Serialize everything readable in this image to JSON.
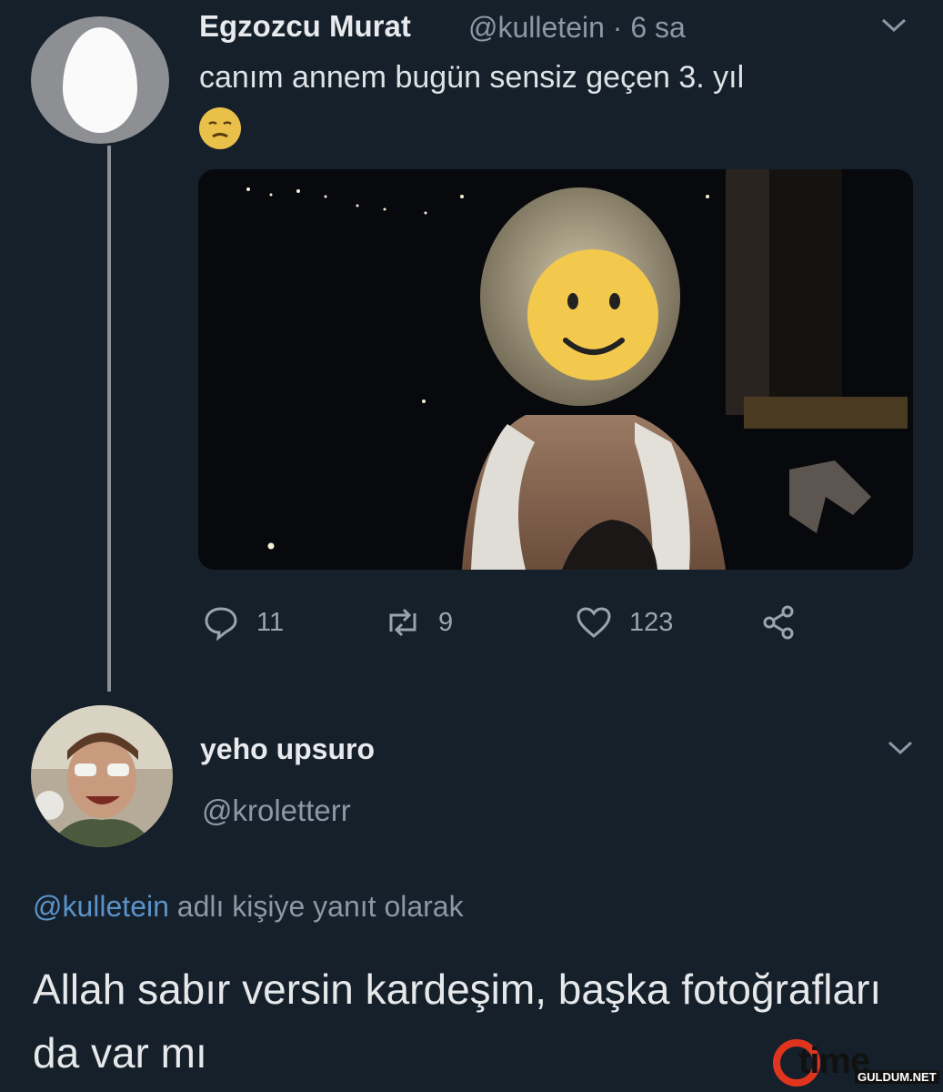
{
  "tweet": {
    "author_name": "Egzozcu Murat",
    "meta": "@kulletein · 6 sa",
    "text": "canım annem bugün sensiz geçen 3. yıl",
    "emoji": "sad-face-emoji",
    "stats": {
      "replies": "11",
      "retweets": "9",
      "likes": "123"
    }
  },
  "reply": {
    "author_name": "yeho upsuro",
    "handle": "@kroletterr",
    "reply_mention": "@kulletein",
    "reply_suffix": " adlı kişiye yanıt olarak",
    "text": "Allah sabır versin kardeşim, başka fotoğrafları da var mı"
  },
  "watermark": {
    "brand": "time",
    "sub": "GULDUM.NET"
  },
  "colors": {
    "background": "#15202b",
    "mention": "#5b93c8",
    "secondary_text": "#8b98a5",
    "smiley": "#f2c94c"
  }
}
